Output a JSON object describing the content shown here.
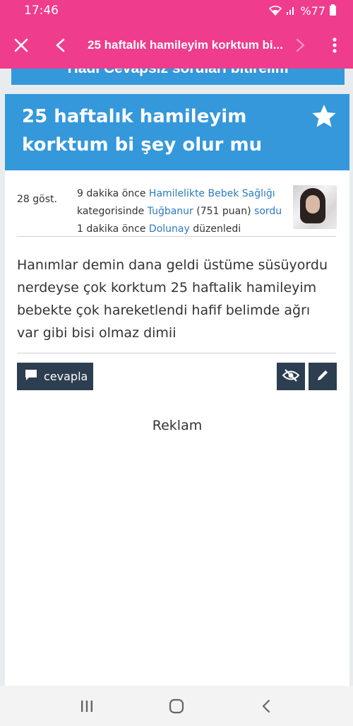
{
  "status_bar": {
    "time": "17:46",
    "battery_text": "%77",
    "icons": [
      "wifi-icon",
      "signal-icon",
      "battery-icon"
    ]
  },
  "toolbar": {
    "title": "25 haftalık hamileyim korktum bi...",
    "icons": [
      "close-icon",
      "back-arrow-icon",
      "forward-arrow-icon",
      "more-vert-icon"
    ]
  },
  "banner": {
    "text": "Hadi Cevapsız soruları bitirelim"
  },
  "question": {
    "title": "25 haftalık hamileyim korktum bi şey olur mu",
    "views": "28 göst.",
    "meta": {
      "time_asked": "9 dakika önce",
      "category": "Hamilelikte Bebek Sağlığı",
      "in_category": "kategorisinde",
      "author": "Tuğbanur",
      "points": "(751 puan)",
      "asked_word": "sordu",
      "time_edited": "1 dakika önce",
      "editor": "Dolunay",
      "edited_word": "düzenledi"
    },
    "body": "Hanımlar demin dana geldi üstüme süsüyordu nerdeyse çok korktum 25 haftalik hamileyim bebekte çok hareketlendi hafif belimde ağrı var gibi bisi olmaz dimii"
  },
  "actions": {
    "reply_label": "cevapla"
  },
  "ad": {
    "label": "Reklam"
  },
  "colors": {
    "accent": "#f03c8c",
    "header_blue": "#3498db",
    "button_dark": "#2c3e50",
    "link": "#2b7bbd"
  }
}
